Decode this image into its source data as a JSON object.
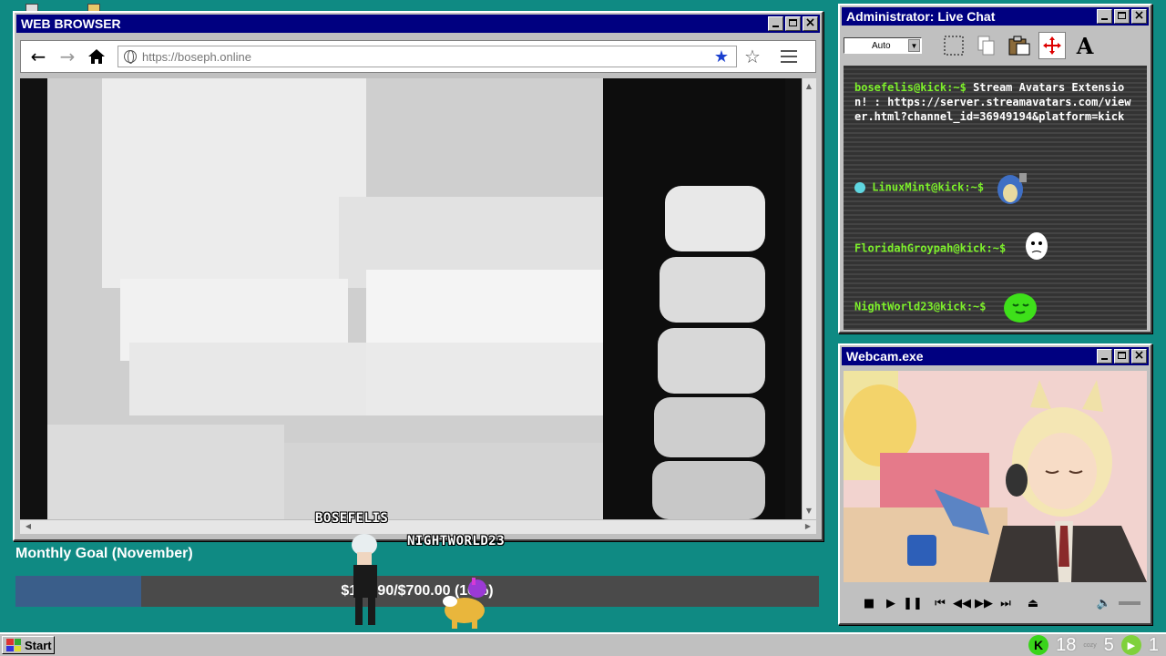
{
  "browser": {
    "title": "WEB BROWSER",
    "url": "https://boseph.online",
    "back_icon": "arrow-left",
    "forward_icon": "arrow-right",
    "home_icon": "home",
    "bookmark_icon": "star-filled",
    "favorite_icon": "star-outline",
    "menu_icon": "hamburger"
  },
  "chat": {
    "title": "Administrator: Live Chat",
    "font_size_select": "Auto",
    "messages": [
      {
        "user": "bosefelis@kick:~$",
        "text": "Stream Avatars Extension! : https://server.streamavatars.com/viewer.html?channel_id=36949194&platform=kick"
      },
      {
        "user": "LinuxMint@kick:~$",
        "text": ""
      },
      {
        "user": "FloridahGroypah@kick:~$",
        "text": ""
      },
      {
        "user": "NightWorld23@kick:~$",
        "text": ""
      }
    ]
  },
  "webcam": {
    "title": "Webcam.exe"
  },
  "goal": {
    "title": "Monthly Goal (November)",
    "text": "$109.90/$700.00 (16%)",
    "progress_fraction": 0.157,
    "fill_color": "#3a5e8a"
  },
  "avatars": [
    {
      "name": "BOSEFELIS"
    },
    {
      "name": "NIGHTWORLD23"
    }
  ],
  "taskbar": {
    "start_label": "Start",
    "tray_num_1": "18",
    "tray_cozy": "cozy",
    "tray_num_2": "5",
    "tray_num_3": "1"
  },
  "colors": {
    "desktop": "#0f8a83",
    "titlebar": "#000080",
    "chat_username": "#7df02b"
  }
}
